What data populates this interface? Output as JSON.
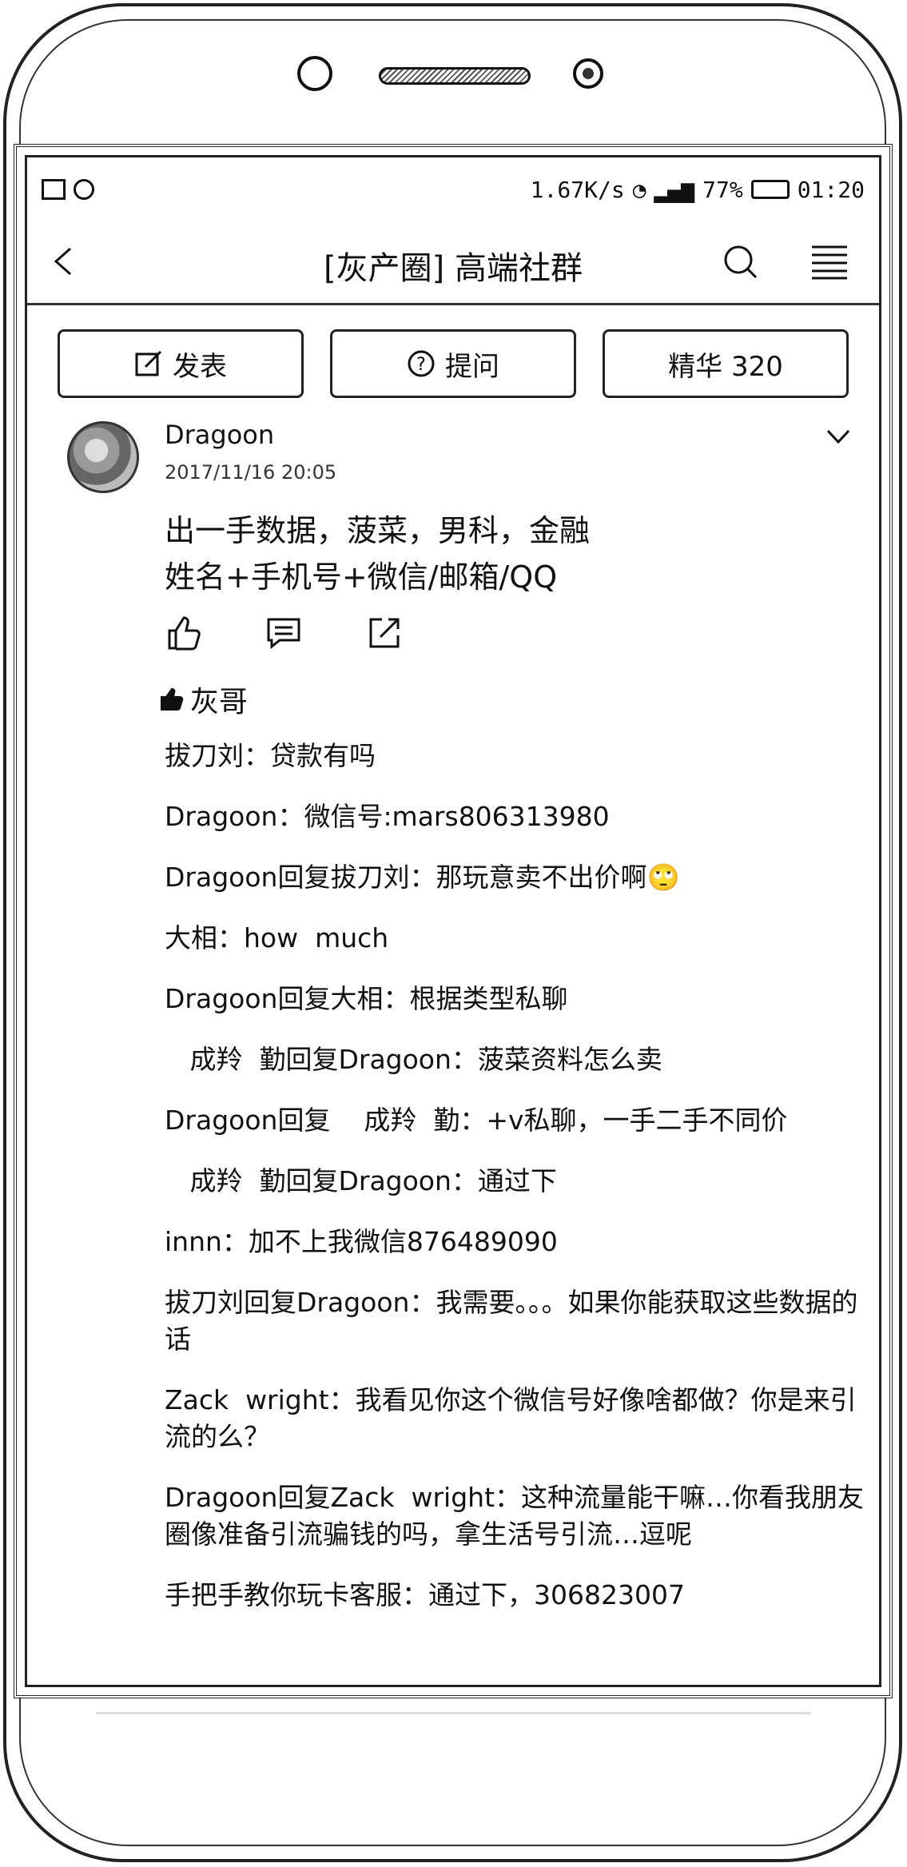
{
  "status_bar": {
    "speed": "1.67K/s",
    "battery": "77%",
    "time": "01:20"
  },
  "nav": {
    "title": "[灰产圈] 高端社群"
  },
  "buttons": {
    "post": "发表",
    "ask": "提问",
    "featured": "精华 320"
  },
  "post": {
    "author": "Dragoon",
    "time": "2017/11/16 20:05",
    "line1": "出一手数据，菠菜，男科，金融",
    "line2": "姓名+手机号+微信/邮箱/QQ",
    "liked_by": "灰哥"
  },
  "comments": [
    "拔刀刘：贷款有吗",
    "Dragoon：微信号:mars806313980",
    "Dragoon回复拔刀刘：那玩意卖不出价啊🙄",
    "大相：how  much",
    "Dragoon回复大相：根据类型私聊",
    "   成羚  勤回复Dragoon：菠菜资料怎么卖",
    "Dragoon回复    成羚  勤：+v私聊，一手二手不同价",
    "   成羚  勤回复Dragoon：通过下",
    "innn：加不上我微信876489090",
    "拔刀刘回复Dragoon：我需要。。。如果你能获取这些数据的话",
    "Zack  wright：我看见你这个微信号好像啥都做？你是来引流的么？",
    "Dragoon回复Zack  wright：这种流量能干嘛…你看我朋友圈像准备引流骗钱的吗，拿生活号引流…逗呢",
    "手把手教你玩卡客服：通过下，306823007"
  ]
}
